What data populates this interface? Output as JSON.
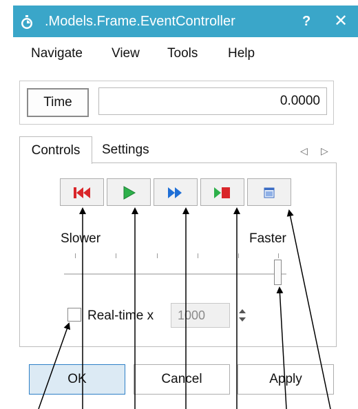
{
  "window": {
    "title": ".Models.Frame.EventController",
    "help_label": "?",
    "close_label": "✕"
  },
  "menu": {
    "items": [
      "Navigate",
      "View",
      "Tools",
      "Help"
    ]
  },
  "time": {
    "button_label": "Time",
    "value": "0.0000"
  },
  "tabs": {
    "controls_label": "Controls",
    "settings_label": "Settings",
    "prev_arrow": "◁",
    "next_arrow": "▷"
  },
  "playback": {
    "buttons": [
      "rewind-icon",
      "play-icon",
      "step-forward-icon",
      "play-to-end-icon",
      "window-icon"
    ]
  },
  "speed": {
    "slower_label": "Slower",
    "faster_label": "Faster"
  },
  "realtime": {
    "checked": false,
    "label": "Real-time x",
    "value": "1000"
  },
  "actions": {
    "ok_label": "OK",
    "cancel_label": "Cancel",
    "apply_label": "Apply"
  },
  "colors": {
    "title_bar": "#3aa6c9",
    "rewind": "#d9262a",
    "play": "#2db04a",
    "step": "#1f6fd6",
    "end_green": "#2db04a",
    "end_red": "#d9262a",
    "ok_fill": "#dceaf4"
  }
}
